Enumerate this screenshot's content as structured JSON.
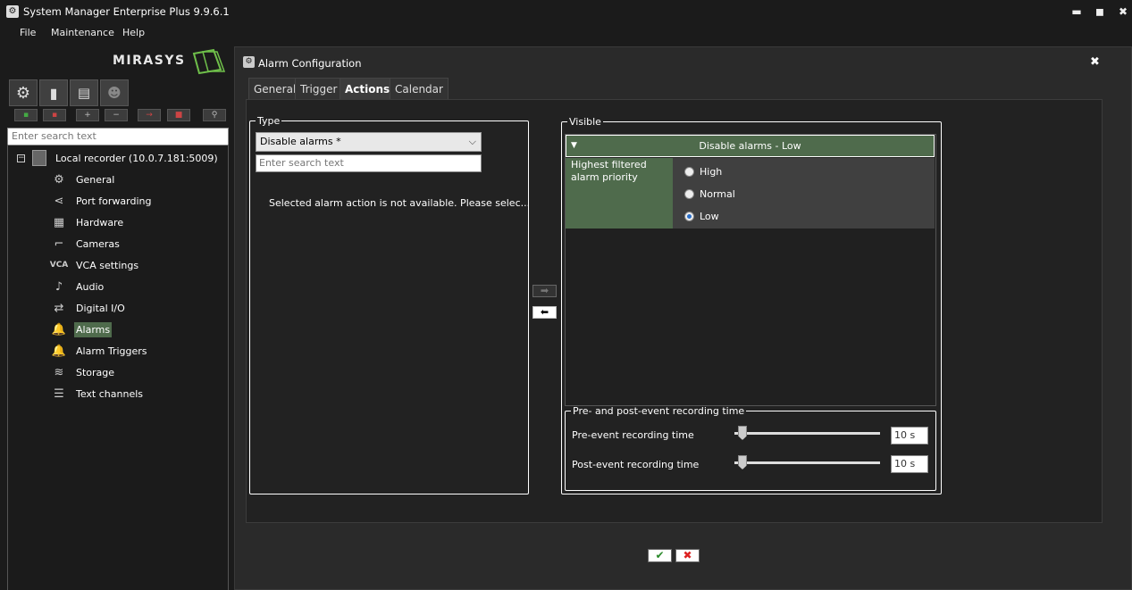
{
  "app": {
    "title": "System Manager Enterprise Plus 9.9.6.1",
    "icon": "gear-app-icon"
  },
  "window_controls": {
    "minimize": "▬",
    "maximize": "◼",
    "close": "✖"
  },
  "menu": {
    "items": [
      "File",
      "Maintenance",
      "Help"
    ]
  },
  "logo": {
    "text": "MIRASYS"
  },
  "sidebar": {
    "tabs": [
      {
        "icon": "gear-icon"
      },
      {
        "icon": "server-icon"
      },
      {
        "icon": "clipboard-icon"
      },
      {
        "icon": "users-icon"
      }
    ],
    "toolbar": [
      {
        "icon": "add-device-icon",
        "glyph": "▪"
      },
      {
        "icon": "remove-device-icon",
        "glyph": "▪"
      },
      {
        "icon": "plus-icon",
        "glyph": "+"
      },
      {
        "icon": "minus-icon",
        "glyph": "−"
      },
      {
        "icon": "move-icon",
        "glyph": "→"
      },
      {
        "icon": "stop-icon",
        "glyph": "■"
      },
      {
        "icon": "plug-icon",
        "glyph": "⚲"
      }
    ],
    "search_placeholder": "Enter search text",
    "tree": {
      "root_label": "Local recorder (10.0.7.181:5009)",
      "items": [
        {
          "label": "General",
          "icon": "gear-icon",
          "glyph": "⚙"
        },
        {
          "label": "Port forwarding",
          "icon": "share-icon",
          "glyph": "⋖"
        },
        {
          "label": "Hardware",
          "icon": "chip-icon",
          "glyph": "▦"
        },
        {
          "label": "Cameras",
          "icon": "camera-icon",
          "glyph": "⌐"
        },
        {
          "label": "VCA settings",
          "icon": "vca-icon",
          "glyph": "VCA"
        },
        {
          "label": "Audio",
          "icon": "microphone-icon",
          "glyph": "♪"
        },
        {
          "label": "Digital I/O",
          "icon": "digital-io-icon",
          "glyph": "⇄"
        },
        {
          "label": "Alarms",
          "icon": "bell-icon",
          "glyph": "🔔"
        },
        {
          "label": "Alarm Triggers",
          "icon": "bell-plus-icon",
          "glyph": "🔔"
        },
        {
          "label": "Storage",
          "icon": "layers-icon",
          "glyph": "≋"
        },
        {
          "label": "Text channels",
          "icon": "list-icon",
          "glyph": "☰"
        }
      ],
      "selected": "Alarms"
    }
  },
  "dialog": {
    "title": "Alarm Configuration",
    "close": "✖",
    "tabs": [
      "General",
      "Trigger",
      "Actions",
      "Calendar"
    ],
    "active_tab": "Actions",
    "type_panel": {
      "legend": "Type",
      "selected": "Disable alarms *",
      "search_placeholder": "Enter search text",
      "message": "Selected alarm action is not available. Please selec..."
    },
    "transfer": {
      "right": "➡",
      "left": "⬅"
    },
    "visible_panel": {
      "legend": "Visible",
      "header": "Disable alarms - Low",
      "priority_label": "Highest filtered alarm priority",
      "options": [
        "High",
        "Normal",
        "Low"
      ],
      "selected_option": "Low"
    },
    "recording": {
      "legend": "Pre- and post-event recording time",
      "pre_label": "Pre-event recording time",
      "pre_value": "10 s",
      "post_label": "Post-event recording time",
      "post_value": "10 s"
    },
    "ok": "✔",
    "cancel": "✖"
  }
}
